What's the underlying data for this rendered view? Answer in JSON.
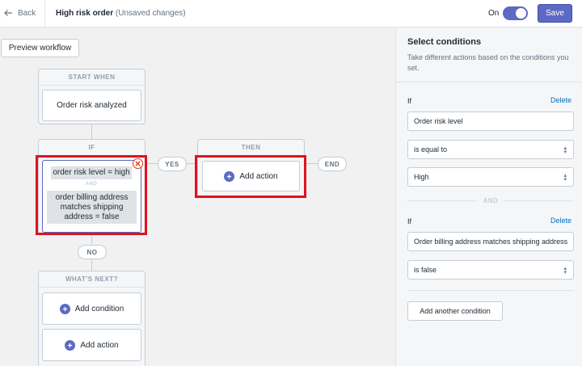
{
  "topbar": {
    "back_label": "Back",
    "title": "High risk order",
    "subtitle": "(Unsaved changes)",
    "toggle_label": "On",
    "toggle_on": true,
    "save_label": "Save",
    "accent_color": "#5c6ac4"
  },
  "canvas": {
    "preview_label": "Preview workflow",
    "start": {
      "header": "START WHEN",
      "trigger": "Order risk analyzed"
    },
    "if_card": {
      "header": "IF",
      "condition1": "order risk level = high",
      "and_label": "AND",
      "condition2": "order billing address matches shipping address = false"
    },
    "yes_label": "YES",
    "no_label": "NO",
    "end_label": "END",
    "then_card": {
      "header": "THEN",
      "add_action": "Add action"
    },
    "next_card": {
      "header": "WHAT'S NEXT?",
      "add_condition": "Add condition",
      "add_action": "Add action"
    },
    "highlight_color": "#e0121d"
  },
  "panel": {
    "title": "Select conditions",
    "description": "Take different actions based on the conditions you set.",
    "block1": {
      "if_label": "If",
      "delete_label": "Delete",
      "property": "Order risk level",
      "operator": "is equal to",
      "value": "High"
    },
    "and_label": "AND",
    "block2": {
      "if_label": "If",
      "delete_label": "Delete",
      "property": "Order billing address matches shipping address",
      "operator": "is false"
    },
    "add_condition_label": "Add another condition"
  },
  "icons": {
    "back": "arrow-left-icon",
    "close": "close-icon",
    "plus": "plus-icon",
    "select_caret": "select-caret-icon"
  }
}
